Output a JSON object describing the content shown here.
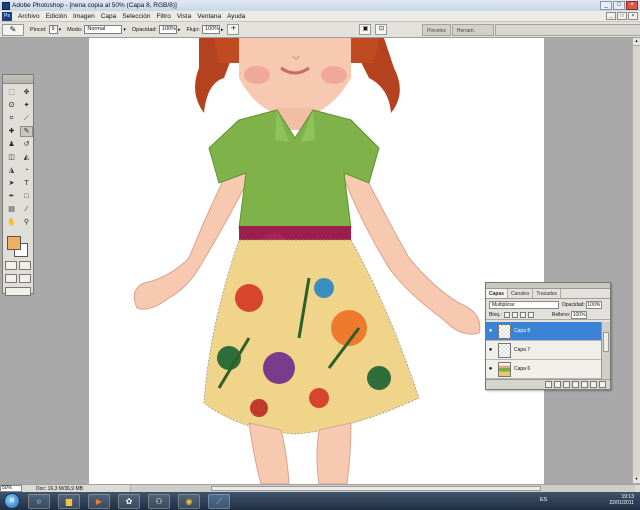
{
  "window": {
    "title": "Adobe Photoshop - [nena copia al 50% (Capa 8, RGB/8)]",
    "min": "_",
    "max": "□",
    "close": "×"
  },
  "menu": {
    "items": [
      "Archivo",
      "Edición",
      "Imagen",
      "Capa",
      "Selección",
      "Filtro",
      "Vista",
      "Ventana",
      "Ayuda"
    ]
  },
  "options": {
    "brush_label": "Pincel:",
    "brush_size": "9",
    "mode_label": "Modo:",
    "mode_value": "Normal",
    "opacity_label": "Opacidad:",
    "opacity_value": "100%",
    "flow_label": "Flujo:",
    "flow_value": "100%",
    "wells": [
      "Pinceles",
      "Herram. preest."
    ]
  },
  "tools": {
    "foreground_color": "#f0b15e",
    "background_color": "#ffffff"
  },
  "layers_panel": {
    "tabs": [
      "Capas",
      "Canales",
      "Trazados"
    ],
    "active_tab": "Capas",
    "blend_mode": "Multiplicar",
    "opacity_label": "Opacidad:",
    "opacity_value": "100%",
    "lock_label": "Bloq.:",
    "fill_label": "Relleno:",
    "fill_value": "100%",
    "layers": [
      {
        "name": "Capa 8",
        "selected": true
      },
      {
        "name": "Capa 7",
        "selected": false
      },
      {
        "name": "Capa 6",
        "selected": false
      }
    ]
  },
  "status": {
    "zoom": "50%",
    "doc": "Doc: 16,3 M/36,9 MB"
  },
  "taskbar": {
    "lang": "ES",
    "time": "19:13",
    "date": "22/01/2011"
  }
}
